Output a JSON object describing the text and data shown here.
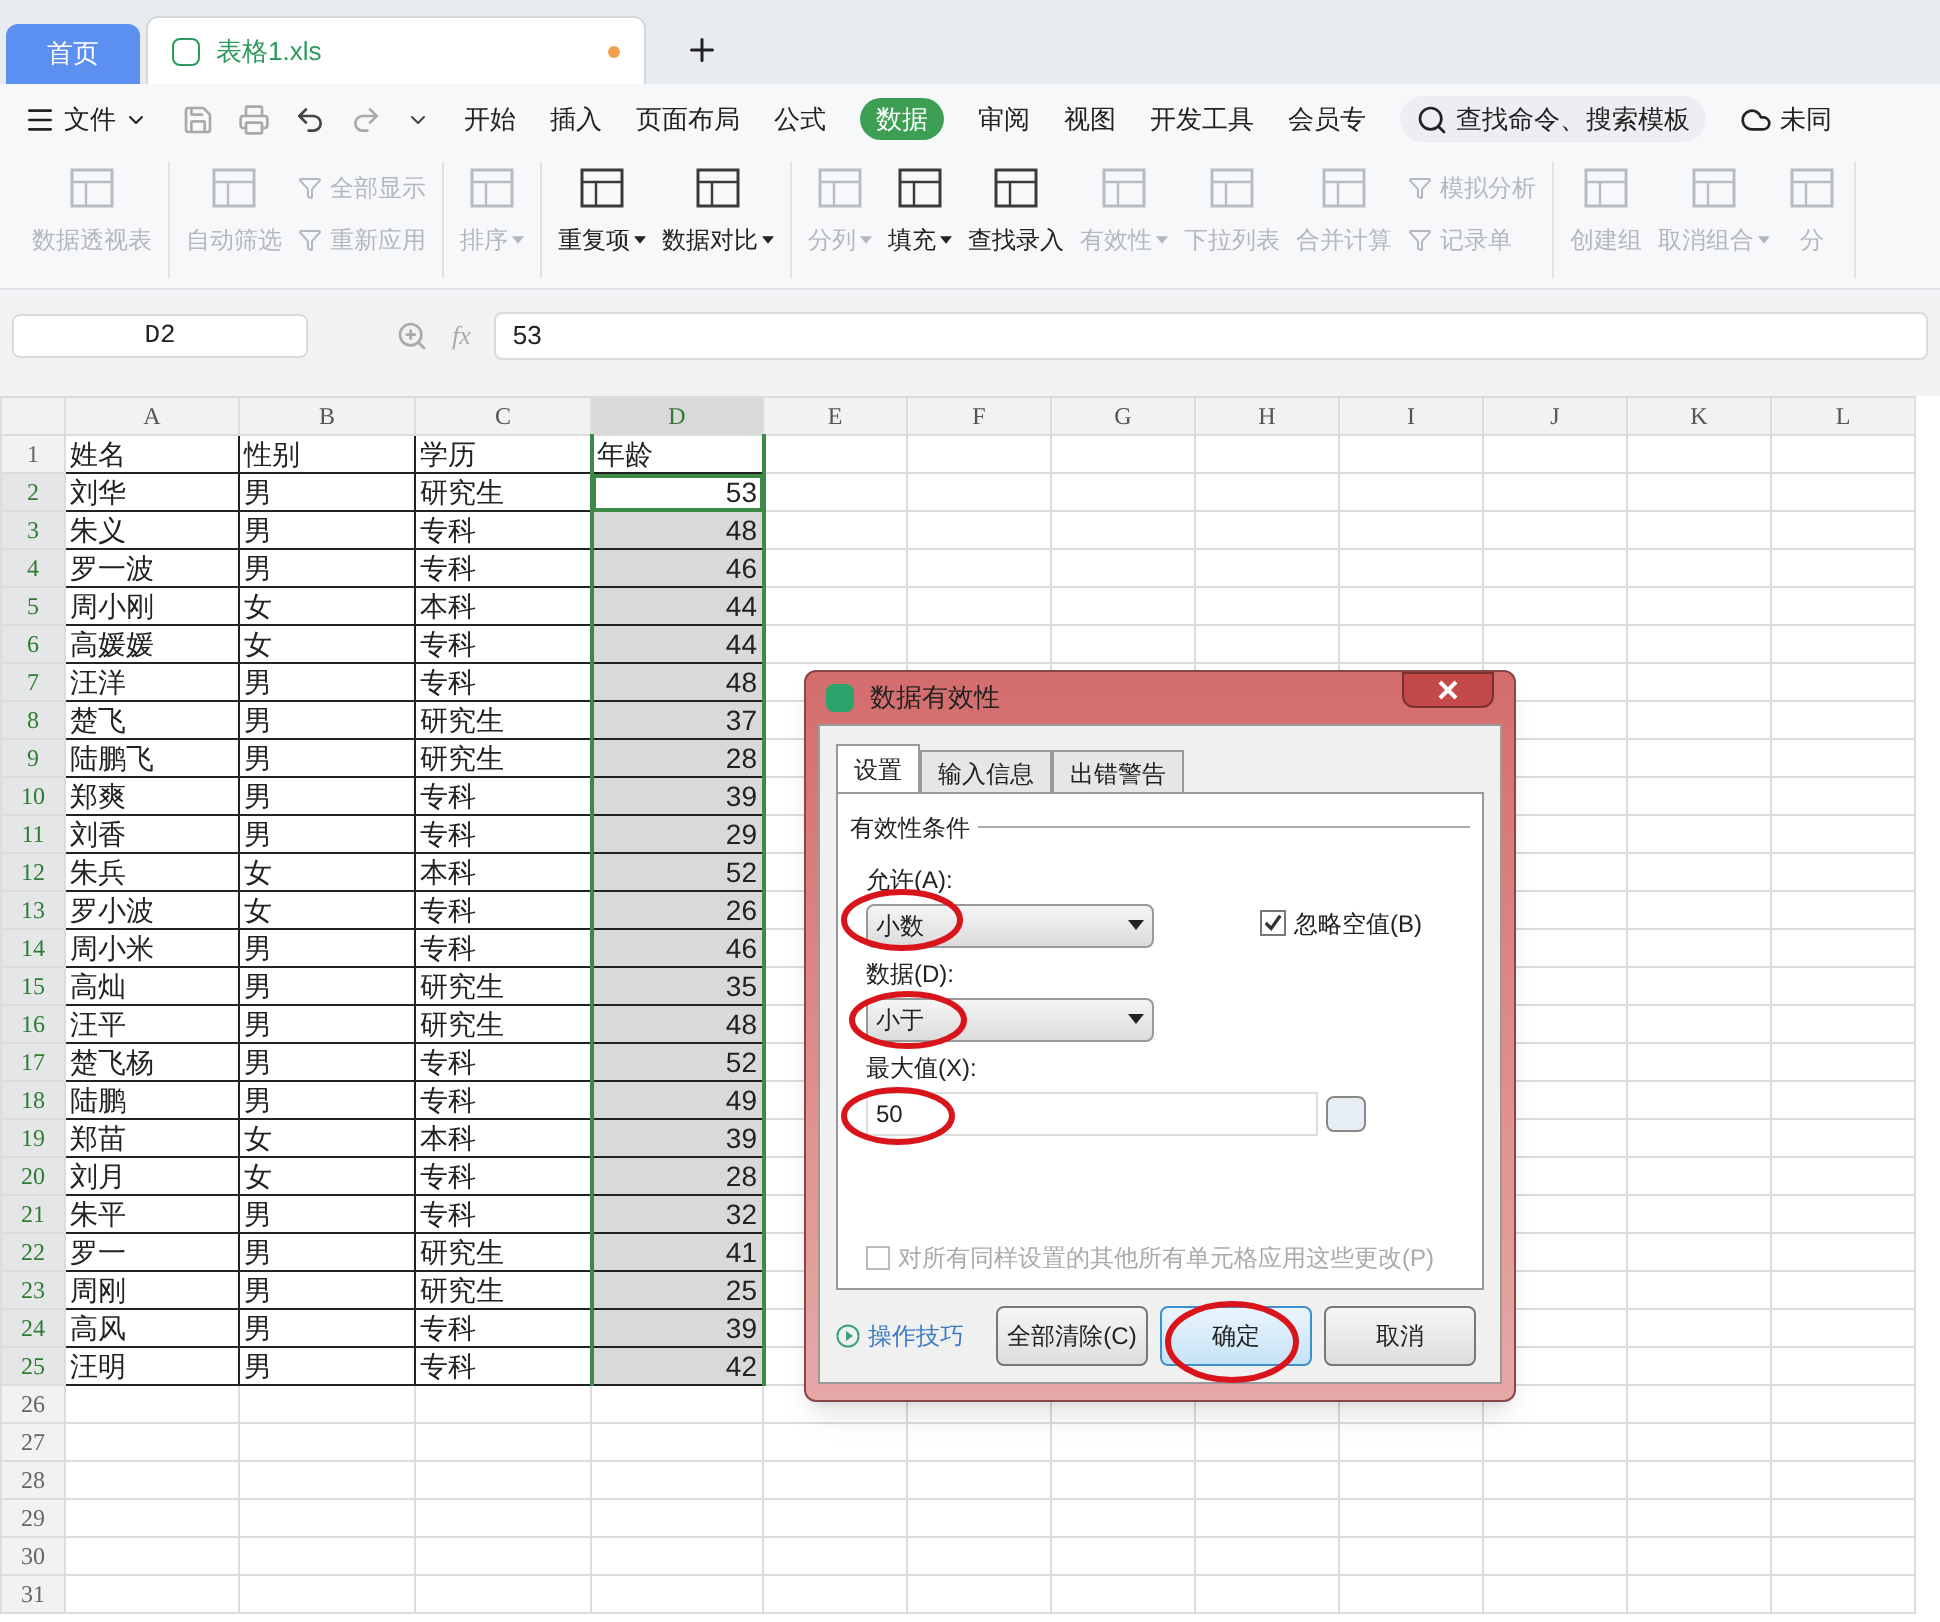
{
  "tabs": [
    {
      "label": "首页",
      "kind": "home",
      "selected": false
    },
    {
      "label": "表格1.xls",
      "kind": "file",
      "selected": true
    }
  ],
  "menu": {
    "file": "文件",
    "items": [
      {
        "label": "开始",
        "selected": false
      },
      {
        "label": "插入",
        "selected": false
      },
      {
        "label": "页面布局",
        "selected": false
      },
      {
        "label": "公式",
        "selected": false
      },
      {
        "label": "数据",
        "selected": true
      },
      {
        "label": "审阅",
        "selected": false
      },
      {
        "label": "视图",
        "selected": false
      },
      {
        "label": "开发工具",
        "selected": false
      },
      {
        "label": "会员专",
        "selected": false
      }
    ],
    "search": "查找命令、搜索模板",
    "sync": "未同"
  },
  "ribbon": [
    [
      {
        "label": "数据透视表",
        "kind": "large",
        "disabled": true,
        "dropdown": false
      }
    ],
    [
      {
        "label": "自动筛选",
        "kind": "large",
        "disabled": true,
        "dropdown": false
      },
      {
        "label": "全部显示",
        "kind": "small",
        "disabled": true,
        "dropdown": false
      },
      {
        "label": "重新应用",
        "kind": "small",
        "disabled": true,
        "dropdown": false
      }
    ],
    [
      {
        "label": "排序",
        "kind": "large",
        "disabled": true,
        "dropdown": true
      }
    ],
    [
      {
        "label": "重复项",
        "kind": "large",
        "disabled": false,
        "dropdown": true
      },
      {
        "label": "数据对比",
        "kind": "large",
        "disabled": false,
        "dropdown": true
      }
    ],
    [
      {
        "label": "分列",
        "kind": "large",
        "disabled": true,
        "dropdown": true
      },
      {
        "label": "填充",
        "kind": "large",
        "disabled": false,
        "dropdown": true
      },
      {
        "label": "查找录入",
        "kind": "large",
        "disabled": false,
        "dropdown": false
      },
      {
        "label": "有效性",
        "kind": "large",
        "disabled": true,
        "dropdown": true
      },
      {
        "label": "下拉列表",
        "kind": "large",
        "disabled": true,
        "dropdown": false
      },
      {
        "label": "合并计算",
        "kind": "large",
        "disabled": true,
        "dropdown": false
      },
      {
        "label": "模拟分析",
        "kind": "small",
        "disabled": true,
        "dropdown": false
      },
      {
        "label": "记录单",
        "kind": "small",
        "disabled": true,
        "dropdown": false
      }
    ],
    [
      {
        "label": "创建组",
        "kind": "large",
        "disabled": true,
        "dropdown": false
      },
      {
        "label": "取消组合",
        "kind": "large",
        "disabled": true,
        "dropdown": true
      },
      {
        "label": "分",
        "kind": "large",
        "disabled": true,
        "dropdown": false
      }
    ]
  ],
  "formula": {
    "cell": "D2",
    "fx": "fx",
    "value": "53"
  },
  "columns": [
    {
      "label": "A",
      "selected": false
    },
    {
      "label": "B",
      "selected": false
    },
    {
      "label": "C",
      "selected": false
    },
    {
      "label": "D",
      "selected": true
    },
    {
      "label": "E",
      "selected": false
    },
    {
      "label": "F",
      "selected": false
    },
    {
      "label": "G",
      "selected": false
    },
    {
      "label": "H",
      "selected": false
    },
    {
      "label": "I",
      "selected": false
    },
    {
      "label": "J",
      "selected": false
    },
    {
      "label": "K",
      "selected": false
    },
    {
      "label": "L",
      "selected": false
    }
  ],
  "rows": [
    {
      "num": "1",
      "cells": [
        "姓名",
        "性别",
        "学历",
        "年龄"
      ],
      "selected": false,
      "active": false
    },
    {
      "num": "2",
      "cells": [
        "刘华",
        "男",
        "研究生",
        "53"
      ],
      "selected": true,
      "active": true
    },
    {
      "num": "3",
      "cells": [
        "朱义",
        "男",
        "专科",
        "48"
      ],
      "selected": true,
      "active": false
    },
    {
      "num": "4",
      "cells": [
        "罗一波",
        "男",
        "专科",
        "46"
      ],
      "selected": true,
      "active": false
    },
    {
      "num": "5",
      "cells": [
        "周小刚",
        "女",
        "本科",
        "44"
      ],
      "selected": true,
      "active": false
    },
    {
      "num": "6",
      "cells": [
        "高媛媛",
        "女",
        "专科",
        "44"
      ],
      "selected": true,
      "active": false
    },
    {
      "num": "7",
      "cells": [
        "汪洋",
        "男",
        "专科",
        "48"
      ],
      "selected": true,
      "active": false
    },
    {
      "num": "8",
      "cells": [
        "楚飞",
        "男",
        "研究生",
        "37"
      ],
      "selected": true,
      "active": false
    },
    {
      "num": "9",
      "cells": [
        "陆鹏飞",
        "男",
        "研究生",
        "28"
      ],
      "selected": true,
      "active": false
    },
    {
      "num": "10",
      "cells": [
        "郑爽",
        "男",
        "专科",
        "39"
      ],
      "selected": true,
      "active": false
    },
    {
      "num": "11",
      "cells": [
        "刘香",
        "男",
        "专科",
        "29"
      ],
      "selected": true,
      "active": false
    },
    {
      "num": "12",
      "cells": [
        "朱兵",
        "女",
        "本科",
        "52"
      ],
      "selected": true,
      "active": false
    },
    {
      "num": "13",
      "cells": [
        "罗小波",
        "女",
        "专科",
        "26"
      ],
      "selected": true,
      "active": false
    },
    {
      "num": "14",
      "cells": [
        "周小米",
        "男",
        "专科",
        "46"
      ],
      "selected": true,
      "active": false
    },
    {
      "num": "15",
      "cells": [
        "高灿",
        "男",
        "研究生",
        "35"
      ],
      "selected": true,
      "active": false
    },
    {
      "num": "16",
      "cells": [
        "汪平",
        "男",
        "研究生",
        "48"
      ],
      "selected": true,
      "active": false
    },
    {
      "num": "17",
      "cells": [
        "楚飞杨",
        "男",
        "专科",
        "52"
      ],
      "selected": true,
      "active": false
    },
    {
      "num": "18",
      "cells": [
        "陆鹏",
        "男",
        "专科",
        "49"
      ],
      "selected": true,
      "active": false
    },
    {
      "num": "19",
      "cells": [
        "郑苗",
        "女",
        "本科",
        "39"
      ],
      "selected": true,
      "active": false
    },
    {
      "num": "20",
      "cells": [
        "刘月",
        "女",
        "专科",
        "28"
      ],
      "selected": true,
      "active": false
    },
    {
      "num": "21",
      "cells": [
        "朱平",
        "男",
        "专科",
        "32"
      ],
      "selected": true,
      "active": false
    },
    {
      "num": "22",
      "cells": [
        "罗一",
        "男",
        "研究生",
        "41"
      ],
      "selected": true,
      "active": false
    },
    {
      "num": "23",
      "cells": [
        "周刚",
        "男",
        "研究生",
        "25"
      ],
      "selected": true,
      "active": false
    },
    {
      "num": "24",
      "cells": [
        "高风",
        "男",
        "专科",
        "39"
      ],
      "selected": true,
      "active": false
    },
    {
      "num": "25",
      "cells": [
        "汪明",
        "男",
        "专科",
        "42"
      ],
      "selected": true,
      "active": false
    },
    {
      "num": "26",
      "cells": [],
      "selected": false,
      "active": false
    },
    {
      "num": "27",
      "cells": [],
      "selected": false,
      "active": false
    },
    {
      "num": "28",
      "cells": [],
      "selected": false,
      "active": false
    },
    {
      "num": "29",
      "cells": [],
      "selected": false,
      "active": false
    },
    {
      "num": "30",
      "cells": [],
      "selected": false,
      "active": false
    },
    {
      "num": "31",
      "cells": [],
      "selected": false,
      "active": false
    }
  ],
  "dialog": {
    "title": "数据有效性",
    "tabs": [
      {
        "label": "设置",
        "selected": true
      },
      {
        "label": "输入信息",
        "selected": false
      },
      {
        "label": "出错警告",
        "selected": false
      }
    ],
    "section": "有效性条件",
    "allow_label": "允许(A):",
    "allow_value": "小数",
    "ignore_blank": {
      "label": "忽略空值(B)",
      "checked": true
    },
    "data_label": "数据(D):",
    "data_value": "小于",
    "max_label": "最大值(X):",
    "max_value": "50",
    "apply_all": {
      "label": "对所有同样设置的其他所有单元格应用这些更改(P)",
      "checked": false,
      "disabled": true
    },
    "tips": "操作技巧",
    "buttons": [
      {
        "label": "全部清除(C)",
        "kind": "normal"
      },
      {
        "label": "确定",
        "kind": "default"
      },
      {
        "label": "取消",
        "kind": "normal"
      }
    ]
  }
}
